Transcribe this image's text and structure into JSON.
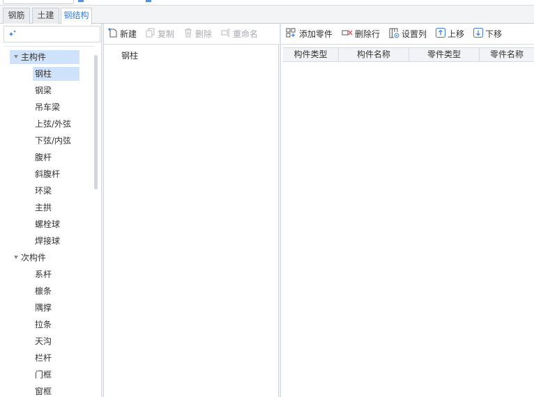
{
  "tabs": [
    {
      "label": "钢筋",
      "active": false
    },
    {
      "label": "土建",
      "active": false
    },
    {
      "label": "钢结构",
      "active": true
    }
  ],
  "tree": {
    "groups": [
      {
        "label": "主构件",
        "expanded": true,
        "selected": true,
        "children": [
          "钢柱",
          "钢梁",
          "吊车梁",
          "上弦/外弦",
          "下弦/内弦",
          "腹杆",
          "斜腹杆",
          "环梁",
          "主拱",
          "螺栓球",
          "焊接球"
        ],
        "selected_child": 0
      },
      {
        "label": "次构件",
        "expanded": true,
        "selected": false,
        "children": [
          "系杆",
          "檩条",
          "隅撑",
          "拉条",
          "天沟",
          "栏杆",
          "门框",
          "窗框"
        ],
        "selected_child": null
      }
    ]
  },
  "middle_toolbar": {
    "new_label": "新建",
    "copy_label": "复制",
    "delete_label": "删除",
    "rename_label": "重命名"
  },
  "middle_list": {
    "items": [
      "钢柱"
    ]
  },
  "right_toolbar": {
    "add_part_label": "添加零件",
    "delete_row_label": "删除行",
    "set_columns_label": "设置列",
    "move_up_label": "上移",
    "move_down_label": "下移"
  },
  "grid": {
    "columns": [
      "构件类型",
      "构件名称",
      "零件类型",
      "零件名称"
    ]
  },
  "colors": {
    "accent": "#3d7de0",
    "selection": "#cfe2fb",
    "disabled_text": "#a6abb3",
    "border": "#d4d9e0"
  }
}
